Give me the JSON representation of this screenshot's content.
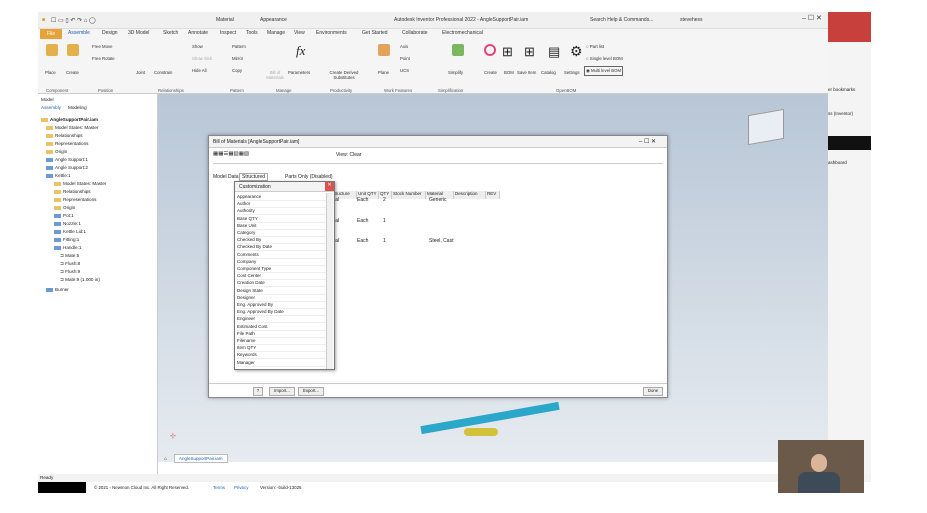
{
  "titlebar": {
    "app_title": "Autodesk Inventor Professional 2022 - AngleSupportPair.iam",
    "search": "Search Help & Commands...",
    "user": "stevehess",
    "material": "Material",
    "appearance": "Appearance"
  },
  "tabs": [
    "File",
    "Assemble",
    "Design",
    "3D Model",
    "Sketch",
    "Annotate",
    "Inspect",
    "Tools",
    "Manage",
    "View",
    "Environments",
    "Get Started",
    "Collaborate",
    "Electromechanical"
  ],
  "ribbon": {
    "place": "Place",
    "create": "Create",
    "free_move": "Free Move",
    "free_rotate": "Free Rotate",
    "joint": "Joint",
    "constrain": "Constrain",
    "show": "Show",
    "show_sick": "Show Sick",
    "hide_all": "Hide All",
    "pattern": "Pattern",
    "mirror": "Mirror",
    "copy": "Copy",
    "bill_of": "Bill of Materials",
    "parameters": "Parameters",
    "create_derived": "Create Derived Substitutes",
    "plane": "Plane",
    "axis": "Axis",
    "point": "Point",
    "ucs": "UCS",
    "simplify": "Simplify",
    "create_bom": "Create",
    "bom": "BOM",
    "save_item": "Save Item",
    "catalog": "Catalog",
    "settings": "Settings",
    "part_list": "Part list",
    "single_level": "Single level BOM",
    "multi_level": "Multi level BOM",
    "sections": {
      "component": "Component",
      "position": "Position",
      "relationships": "Relationships",
      "pattern": "Pattern",
      "manage": "Manage",
      "productivity": "Productivity",
      "work_features": "Work Features",
      "simplification": "Simplification",
      "openbom": "OpenBOM"
    }
  },
  "modeltree": {
    "header": "Model",
    "tabs": [
      "Assembly",
      "Modeling"
    ],
    "items": [
      "AngleSupportPair.iam",
      "Model States: Master",
      "Relationships",
      "Representations",
      "Origin",
      "Angle Support:1",
      "Angle Support:2",
      "Kettle:1",
      "Model States: Master",
      "Relationships",
      "Representations",
      "Origin",
      "Pot:1",
      "Nozzle:1",
      "Kettle Lid:1",
      "Fitting:1",
      "Handle:1",
      "Mate:5",
      "Flush:8",
      "Flush:9",
      "Mate:9 (1.000 in)",
      "Burner"
    ]
  },
  "viewport": {
    "doc_tab": "AngleSupportPair.iam"
  },
  "status": {
    "ready": "Ready",
    "copyright": "© 2021 - Newmon Cloud Inc. All Right Reserved.",
    "terms": "Terms",
    "privacy": "Privacy",
    "version": "Version: -build-13026"
  },
  "bom": {
    "title": "Bill of Materials [AngleSupportPair.iam]",
    "tabs": [
      "Model Data",
      "Structured",
      "Parts Only (Disabled)"
    ],
    "filter": "View: Clear",
    "columns": [
      "Item",
      "BOM Structure",
      "Unit QTY",
      "QTY",
      "Stock Number",
      "Material",
      "Description",
      "REV"
    ],
    "rows": [
      {
        "structure": "Normal",
        "unit": "Each",
        "qty": "2",
        "material": "Generic"
      },
      {
        "structure": "Normal",
        "unit": "Each",
        "qty": "1",
        "material": ""
      },
      {
        "structure": "Normal",
        "unit": "Each",
        "qty": "1",
        "material": "Steel, Cast"
      }
    ],
    "import": "Import...",
    "export": "Export...",
    "done": "Done"
  },
  "customization": {
    "title": "Customization",
    "items": [
      "Appearance",
      "Author",
      "Authority",
      "Base QTY",
      "Base Unit",
      "Category",
      "Checked By",
      "Checked By Date",
      "Comments",
      "Company",
      "Component Type",
      "Cost Center",
      "Creation Date",
      "Design State",
      "Designer",
      "Eng. Approved By",
      "Eng. Approved By Date",
      "Engineer",
      "Estimated Cost",
      "File Path",
      "Filename",
      "Item QTY",
      "Keywords",
      "Manager"
    ]
  },
  "right_panel": {
    "bookmarks": "er bookmarks",
    "inventor": "ss (Inventor)",
    "dashboard": "ashboard"
  }
}
